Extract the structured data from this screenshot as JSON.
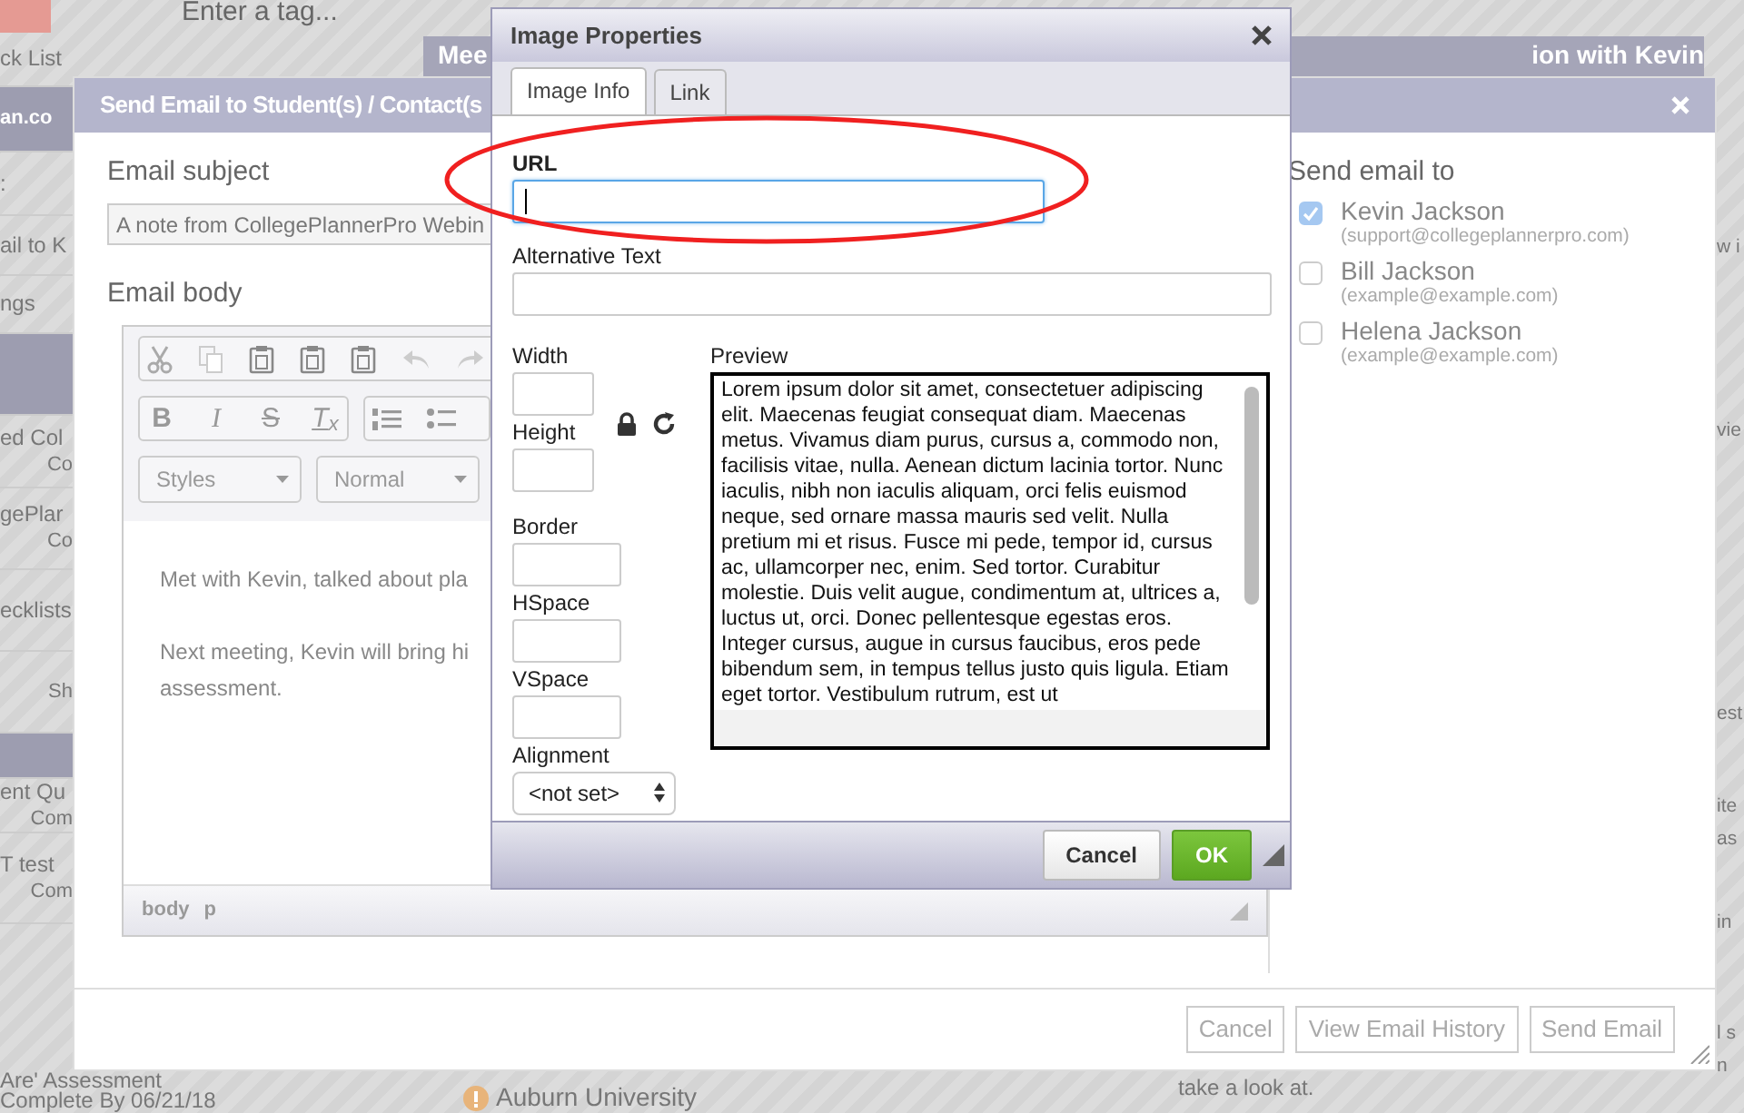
{
  "background_page": {
    "tag_field": {
      "placeholder": "Enter a tag..."
    },
    "meeting_band": {
      "texts": [
        "Mee",
        "ion with Kevin"
      ]
    },
    "left_items": [
      {
        "kind": "row",
        "title": "ck List"
      },
      {
        "kind": "band",
        "title": "an.co"
      },
      {
        "kind": "toggle",
        "title": ":"
      },
      {
        "kind": "row",
        "title": "ail to K"
      },
      {
        "kind": "row",
        "title": "ngs"
      },
      {
        "kind": "band"
      },
      {
        "kind": "row",
        "title": "ed Col",
        "subtitle": "Co"
      },
      {
        "kind": "row",
        "title": "gePlar",
        "subtitle": "Co"
      },
      {
        "kind": "row",
        "title": "ecklists"
      },
      {
        "kind": "row",
        "subtitle": "Sh"
      },
      {
        "kind": "band"
      },
      {
        "kind": "row",
        "title": "ent Qu",
        "subtitle": "Com"
      },
      {
        "kind": "row",
        "title": "T test",
        "subtitle": "Com"
      }
    ],
    "right_items": [
      {
        "text": "w i"
      },
      {
        "text": "vie"
      },
      {
        "text": "est"
      },
      {
        "text": "ite"
      },
      {
        "text": "as"
      },
      {
        "text": "in"
      },
      {
        "text": "l s"
      },
      {
        "text": "n"
      }
    ],
    "bottom": {
      "task_title": "Are' Assessment",
      "task_due": "Complete By 06/21/18",
      "college": "Auburn University",
      "note": "take a look at."
    }
  },
  "email_dialog": {
    "title": "Send Email to Student(s) / Contact(s",
    "subject_label": "Email subject",
    "subject_value": "A note from CollegePlannerPro Webin",
    "body_label": "Email body",
    "editor": {
      "format_buttons": [
        {
          "kind": "bold",
          "label": "B"
        },
        {
          "kind": "italic",
          "label": "I"
        },
        {
          "kind": "strike",
          "label": "S"
        },
        {
          "kind": "clear",
          "label": "T$_{x}$"
        }
      ],
      "dropdowns": [
        "Styles",
        "Normal"
      ],
      "paragraphs": [
        [
          "Met with Kevin, talked about pla"
        ],
        [
          "Next meeting, Kevin will bring hi",
          "assessment."
        ]
      ],
      "path": [
        "body",
        "p"
      ]
    },
    "recipients_label": "Send email to",
    "recipients": [
      {
        "name": "Kevin Jackson",
        "email": "(support@collegeplannerpro.com)",
        "checked": true
      },
      {
        "name": "Bill Jackson",
        "email": "(example@example.com)",
        "checked": false
      },
      {
        "name": "Helena Jackson",
        "email": "(example@example.com)",
        "checked": false
      }
    ],
    "buttons": [
      "Cancel",
      "View Email History",
      "Send Email"
    ]
  },
  "image_dialog": {
    "title": "Image Properties",
    "tabs": [
      {
        "label": "Image Info",
        "selected": true
      },
      {
        "label": "Link",
        "selected": false
      }
    ],
    "url": {
      "label": "URL",
      "focused": true
    },
    "alt_text": {
      "label": "Alternative Text"
    },
    "fields": [
      {
        "label": "Width"
      },
      {
        "label": "Height"
      },
      {
        "label": "Border"
      },
      {
        "label": "HSpace"
      },
      {
        "label": "VSpace"
      }
    ],
    "alignment": {
      "label": "Alignment",
      "value": "<not set>"
    },
    "preview": {
      "label": "Preview",
      "text": "Lorem ipsum dolor sit amet, consectetuer adipiscing elit. Maecenas feugiat consequat diam. Maecenas metus. Vivamus diam purus, cursus a, commodo non, facilisis vitae, nulla. Aenean dictum lacinia tortor. Nunc iaculis, nibh non iaculis aliquam, orci felis euismod neque, sed ornare massa mauris sed velit. Nulla pretium mi et risus. Fusce mi pede, tempor id, cursus ac, ullamcorper nec, enim. Sed tortor. Curabitur molestie. Duis velit augue, condimentum at, ultrices a, luctus ut, orci. Donec pellentesque egestas eros. Integer cursus, augue in cursus faucibus, eros pede bibendum sem, in tempus tellus justo quis ligula. Etiam eget tortor. Vestibulum rutrum, est ut"
    },
    "buttons": [
      {
        "label": "Cancel",
        "kind": "secondary"
      },
      {
        "label": "OK",
        "kind": "primary"
      }
    ]
  }
}
